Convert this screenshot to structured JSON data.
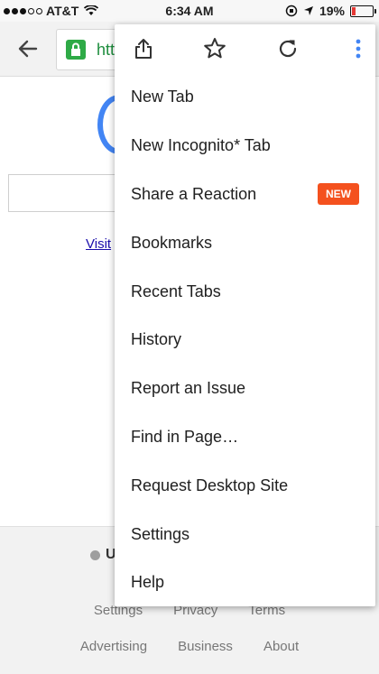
{
  "status_bar": {
    "carrier": "AT&T",
    "time": "6:34 AM",
    "battery": "19%",
    "battery_level": 0.19
  },
  "toolbar": {
    "url_fragment": "htt"
  },
  "page": {
    "visit_link": "Visit",
    "footer_location": "U",
    "footer_links_row1": [
      "Settings",
      "Privacy",
      "Terms"
    ],
    "footer_links_row2": [
      "Advertising",
      "Business",
      "About"
    ]
  },
  "menu": {
    "icons": [
      "share-icon",
      "star-icon",
      "reload-icon",
      "more-vert-icon"
    ],
    "items": [
      {
        "label": "New Tab"
      },
      {
        "label": "New Incognito* Tab"
      },
      {
        "label": "Share a Reaction",
        "badge": "NEW"
      },
      {
        "label": "Bookmarks"
      },
      {
        "label": "Recent Tabs"
      },
      {
        "label": "History"
      },
      {
        "label": "Report an Issue"
      },
      {
        "label": "Find in Page…"
      },
      {
        "label": "Request Desktop Site"
      },
      {
        "label": "Settings"
      },
      {
        "label": "Help"
      }
    ]
  },
  "colors": {
    "accent_badge": "#f4511e",
    "lock_green": "#2eaa46",
    "more_icon_blue": "#4285f4"
  }
}
